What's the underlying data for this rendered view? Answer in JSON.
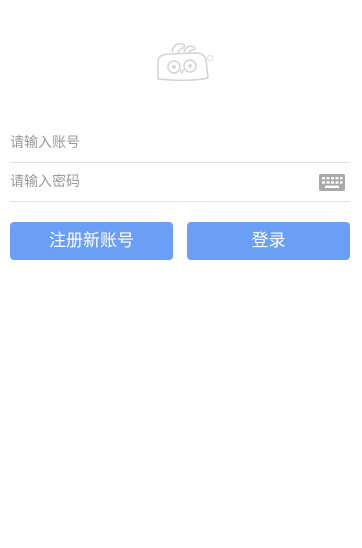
{
  "logo": {
    "icon": "owl-logo-icon"
  },
  "account": {
    "placeholder": "请输入账号",
    "value": ""
  },
  "password": {
    "placeholder": "请输入密码",
    "value": "",
    "keyboard_icon": "keyboard-icon"
  },
  "buttons": {
    "register_label": "注册新账号",
    "login_label": "登录"
  },
  "colors": {
    "primary": "#6b9ff6",
    "placeholder": "#999999",
    "divider": "#e3e3e3",
    "logo_stroke": "#d0d0d0"
  }
}
